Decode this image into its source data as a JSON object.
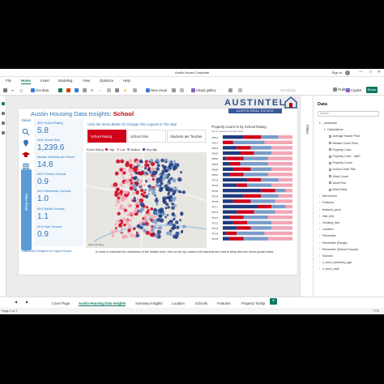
{
  "window": {
    "title": "Austin House Complete",
    "sign_in": "Sign in"
  },
  "menu": [
    "File",
    "Home",
    "Insert",
    "Modeling",
    "View",
    "Optimize",
    "Help"
  ],
  "menu_active_index": 1,
  "ribbon": {
    "get_data": "Get data",
    "new_visual": "New visual",
    "visual_gallery": "Visual gallery",
    "sensitivity": "Sensitivity",
    "publish": "Publish",
    "copilot": "Copilot",
    "share": "Share"
  },
  "report": {
    "title_prefix": "Austin Housing Data Insights: ",
    "title_highlight": "School",
    "logo_text": "AUSTINTEL",
    "logo_sub": "AUSTIN REAL ESTATE INSIGHTS",
    "views_label": "Views",
    "filter_panel_label": "Filter Panel",
    "instruction": "Click the Items Below To Change The Legend In The Map",
    "tabs": [
      "School Rating",
      "School Size",
      "Students per Teacher"
    ],
    "tabs_active_index": 0,
    "kpis": [
      {
        "label": "AVG School Rating",
        "value": "5.8"
      },
      {
        "label": "AVG School Size",
        "value": "1,239.6"
      },
      {
        "label": "Median Students per School",
        "value": "14.8"
      },
      {
        "label": "AVG Primary Schools",
        "value": "0.9"
      },
      {
        "label": "AVG Elementary Schools",
        "value": "1.0"
      },
      {
        "label": "AVG Middle Schools",
        "value": "1.1"
      },
      {
        "label": "AVG High Schools",
        "value": "0.9"
      }
    ],
    "map_legend": {
      "title": "School Rating",
      "items": [
        {
          "label": "High",
          "color": "#d0021b"
        },
        {
          "label": "Low",
          "color": "#f4a6b6"
        },
        {
          "label": "Medium",
          "color": "#7a9cc9"
        },
        {
          "label": "Very High",
          "color": "#1f3b80"
        }
      ]
    },
    "map_credit": "Microsoft Bing",
    "footer_note": "Dashboard Designed by Yogesh Kumar",
    "footer_instruction": "In order to minimize the usefulness of the bubble chart, click on the zip codes in the stacked bar chart to deep dive into those postal codes."
  },
  "bar_chart_title": "Property Count % by School Rating",
  "bar_chart_subtitle": "Items Located on Austin Map",
  "chart_data": {
    "type": "bar",
    "orientation": "horizontal",
    "stacked_percent": true,
    "title": "Property Count % by School Rating",
    "categories": [
      "78613",
      "78617",
      "78619",
      "78620",
      "78652",
      "78653",
      "78660",
      "78664",
      "78701",
      "78702",
      "78703",
      "78704",
      "78705",
      "78717",
      "78719",
      "78721",
      "78722",
      "78723",
      "78724",
      "78725"
    ],
    "series": [
      {
        "name": "Very High",
        "color": "#1f3b80",
        "values": [
          0.3,
          0.0,
          0.2,
          0.25,
          0.05,
          0.1,
          0.15,
          0.1,
          0.35,
          0.2,
          0.55,
          0.3,
          0.15,
          0.5,
          0.2,
          0.1,
          0.15,
          0.2,
          0.05,
          0.1
        ]
      },
      {
        "name": "High",
        "color": "#d0021b",
        "values": [
          0.25,
          0.15,
          0.2,
          0.2,
          0.25,
          0.15,
          0.25,
          0.2,
          0.2,
          0.15,
          0.2,
          0.25,
          0.25,
          0.2,
          0.25,
          0.2,
          0.2,
          0.2,
          0.15,
          0.2
        ]
      },
      {
        "name": "Medium",
        "color": "#7a9cc9",
        "values": [
          0.25,
          0.45,
          0.3,
          0.25,
          0.35,
          0.4,
          0.3,
          0.35,
          0.25,
          0.35,
          0.15,
          0.25,
          0.35,
          0.2,
          0.3,
          0.35,
          0.35,
          0.3,
          0.4,
          0.35
        ]
      },
      {
        "name": "Low",
        "color": "#f4a6b6",
        "values": [
          0.2,
          0.4,
          0.3,
          0.3,
          0.35,
          0.35,
          0.3,
          0.35,
          0.2,
          0.3,
          0.1,
          0.2,
          0.25,
          0.1,
          0.25,
          0.35,
          0.3,
          0.3,
          0.4,
          0.35
        ]
      }
    ]
  },
  "data_pane": {
    "title": "Data",
    "search_placeholder": "Search",
    "items": [
      {
        "label": "_measures",
        "type": "folder",
        "depth": 0
      },
      {
        "label": "Calculations",
        "type": "folder",
        "depth": 1
      },
      {
        "label": "Average House Price",
        "type": "field",
        "depth": 2
      },
      {
        "label": "Median Home Price",
        "type": "field",
        "depth": 2
      },
      {
        "label": "Property Color",
        "type": "field",
        "depth": 2
      },
      {
        "label": "Property Color - MAP",
        "type": "field",
        "depth": 2
      },
      {
        "label": "Property Count",
        "type": "field",
        "depth": 2
      },
      {
        "label": "School Chart Title",
        "type": "field",
        "depth": 2
      },
      {
        "label": "Word Count",
        "type": "field",
        "depth": 2
      },
      {
        "label": "Word Find",
        "type": "field",
        "depth": 2
      },
      {
        "label": "Word Rank",
        "type": "field",
        "depth": 2
      },
      {
        "label": "Dim.school",
        "type": "table",
        "depth": 0
      },
      {
        "label": "Features",
        "type": "table",
        "depth": 0
      },
      {
        "label": "features_pivot",
        "type": "table",
        "depth": 0
      },
      {
        "label": "Hist_Info",
        "type": "table",
        "depth": 0
      },
      {
        "label": "Housing_fact",
        "type": "table",
        "depth": 0
      },
      {
        "label": "Location",
        "type": "table",
        "depth": 0
      },
      {
        "label": "Parameter",
        "type": "table",
        "depth": 0
      },
      {
        "label": "Parameter (Range)",
        "type": "table",
        "depth": 0
      },
      {
        "label": "Parameter (School Groups)",
        "type": "table",
        "depth": 0
      },
      {
        "label": "Schools",
        "type": "table",
        "depth": 0
      },
      {
        "label": "z_word_summary_pge",
        "type": "table",
        "depth": 0
      },
      {
        "label": "z_word_rank",
        "type": "table",
        "depth": 0
      }
    ]
  },
  "filters_label": "Filters",
  "page_tabs": [
    "Cover Page",
    "Austin Housing Data Insights",
    "Summary Insights",
    "Location",
    "Schools",
    "Features",
    "Property Tooltip"
  ],
  "page_tabs_active_index": 1,
  "status": {
    "page": "Page 2 of 7",
    "zoom": "77%"
  }
}
